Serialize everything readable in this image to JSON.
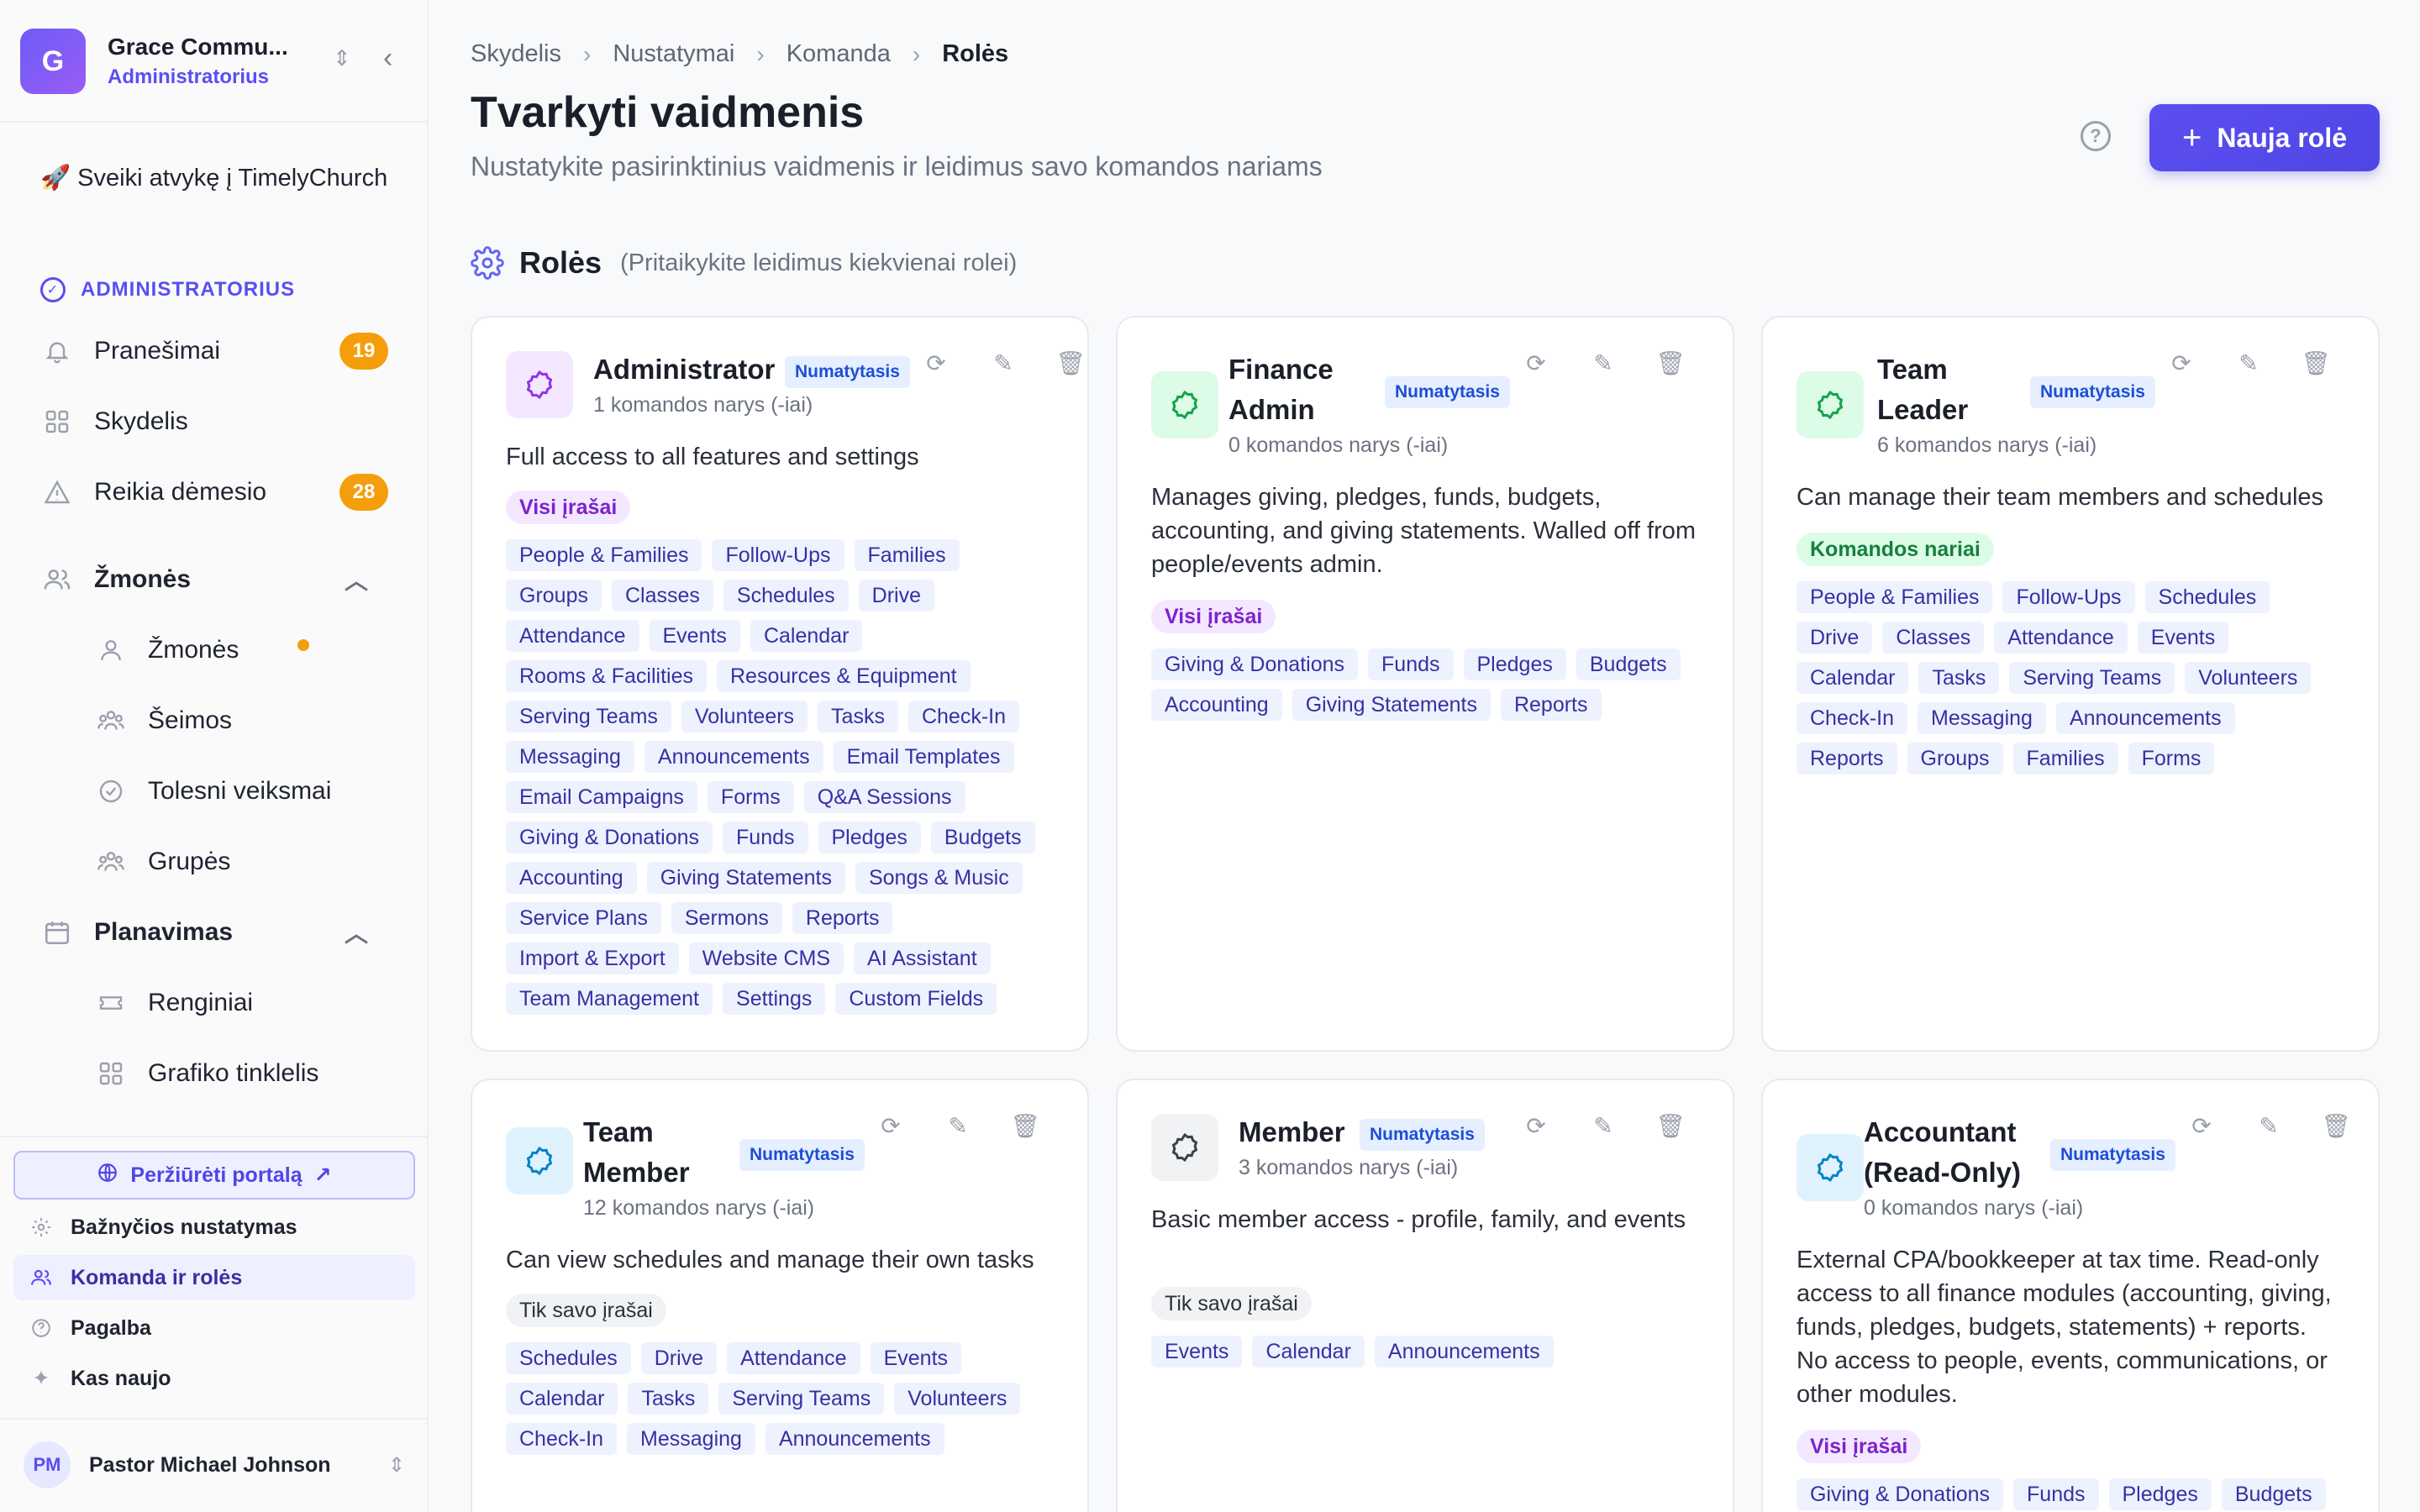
{
  "sidebar": {
    "org_initial": "G",
    "org_name": "Grace Commu...",
    "org_role": "Administratorius",
    "welcome": "🚀 Sveiki atvykę į TimelyChurch",
    "section": "ADMINISTRATORIUS",
    "items": {
      "notifications": {
        "label": "Pranešimai",
        "badge": "19"
      },
      "dashboard": {
        "label": "Skydelis"
      },
      "attention": {
        "label": "Reikia dėmesio",
        "badge": "28"
      }
    },
    "people_group": {
      "label": "Žmonės",
      "items": [
        "Žmonės",
        "Šeimos",
        "Tolesni veiksmai",
        "Grupės"
      ]
    },
    "planning_group": {
      "label": "Planavimas",
      "items": [
        "Renginiai",
        "Grafiko tinklelis"
      ]
    },
    "portal_button": "Peržiūrėti portalą",
    "footer": {
      "church_settings": "Bažnyčios nustatymas",
      "team_roles": "Komanda ir rolės",
      "help": "Pagalba",
      "whats_new": "Kas naujo"
    },
    "user": {
      "initials": "PM",
      "name": "Pastor Michael Johnson"
    }
  },
  "breadcrumb": [
    "Skydelis",
    "Nustatymai",
    "Komanda",
    "Rolės"
  ],
  "header": {
    "title": "Tvarkyti vaidmenis",
    "subtitle": "Nustatykite pasirinktinius vaidmenis ir leidimus savo komandos nariams",
    "new_role": "Nauja rolė"
  },
  "roles_section": {
    "title": "Rolės",
    "hint": "(Pritaikykite leidimus kiekvienai rolei)"
  },
  "colors": {
    "accent": "#5b4ef0",
    "badge_orange": "#f59e0b"
  },
  "roles": [
    {
      "name": "Administrator",
      "badge": "Numatytasis",
      "count": "1 komandos narys (-iai)",
      "description": "Full access to all features and settings",
      "scope": "Visi įrašai",
      "perms": [
        "People & Families",
        "Follow-Ups",
        "Families",
        "Groups",
        "Classes",
        "Schedules",
        "Drive",
        "Attendance",
        "Events",
        "Calendar",
        "Rooms & Facilities",
        "Resources & Equipment",
        "Serving Teams",
        "Volunteers",
        "Tasks",
        "Check-In",
        "Messaging",
        "Announcements",
        "Email Templates",
        "Email Campaigns",
        "Forms",
        "Q&A Sessions",
        "Giving & Donations",
        "Funds",
        "Pledges",
        "Budgets",
        "Accounting",
        "Giving Statements",
        "Songs & Music",
        "Service Plans",
        "Sermons",
        "Reports",
        "Import & Export",
        "Website CMS",
        "AI Assistant",
        "Team Management",
        "Settings",
        "Custom Fields"
      ]
    },
    {
      "name": "Finance Admin",
      "badge": "Numatytasis",
      "count": "0 komandos narys (-iai)",
      "description": "Manages giving, pledges, funds, budgets, accounting, and giving statements. Walled off from people/events admin.",
      "scope": "Visi įrašai",
      "perms": [
        "Giving & Donations",
        "Funds",
        "Pledges",
        "Budgets",
        "Accounting",
        "Giving Statements",
        "Reports"
      ]
    },
    {
      "name": "Team Leader",
      "badge": "Numatytasis",
      "count": "6 komandos narys (-iai)",
      "description": "Can manage their team members and schedules",
      "scope": "Komandos nariai",
      "perms": [
        "People & Families",
        "Follow-Ups",
        "Schedules",
        "Drive",
        "Classes",
        "Attendance",
        "Events",
        "Calendar",
        "Tasks",
        "Serving Teams",
        "Volunteers",
        "Check-In",
        "Messaging",
        "Announcements",
        "Reports",
        "Groups",
        "Families",
        "Forms"
      ]
    },
    {
      "name": "Team Member",
      "badge": "Numatytasis",
      "count": "12 komandos narys (-iai)",
      "description": "Can view schedules and manage their own tasks",
      "scope": "Tik savo įrašai",
      "perms": [
        "Schedules",
        "Drive",
        "Attendance",
        "Events",
        "Calendar",
        "Tasks",
        "Serving Teams",
        "Volunteers",
        "Check-In",
        "Messaging",
        "Announcements"
      ]
    },
    {
      "name": "Member",
      "badge": "Numatytasis",
      "count": "3 komandos narys (-iai)",
      "description": "Basic member access - profile, family, and events",
      "scope": "Tik savo įrašai",
      "perms": [
        "Events",
        "Calendar",
        "Announcements"
      ]
    },
    {
      "name": "Accountant (Read-Only)",
      "badge": "Numatytasis",
      "count": "0 komandos narys (-iai)",
      "description": "External CPA/bookkeeper at tax time. Read-only access to all finance modules (accounting, giving, funds, pledges, budgets, statements) + reports. No access to people, events, communications, or other modules.",
      "scope": "Visi įrašai",
      "perms": [
        "Giving & Donations",
        "Funds",
        "Pledges",
        "Budgets"
      ]
    }
  ]
}
